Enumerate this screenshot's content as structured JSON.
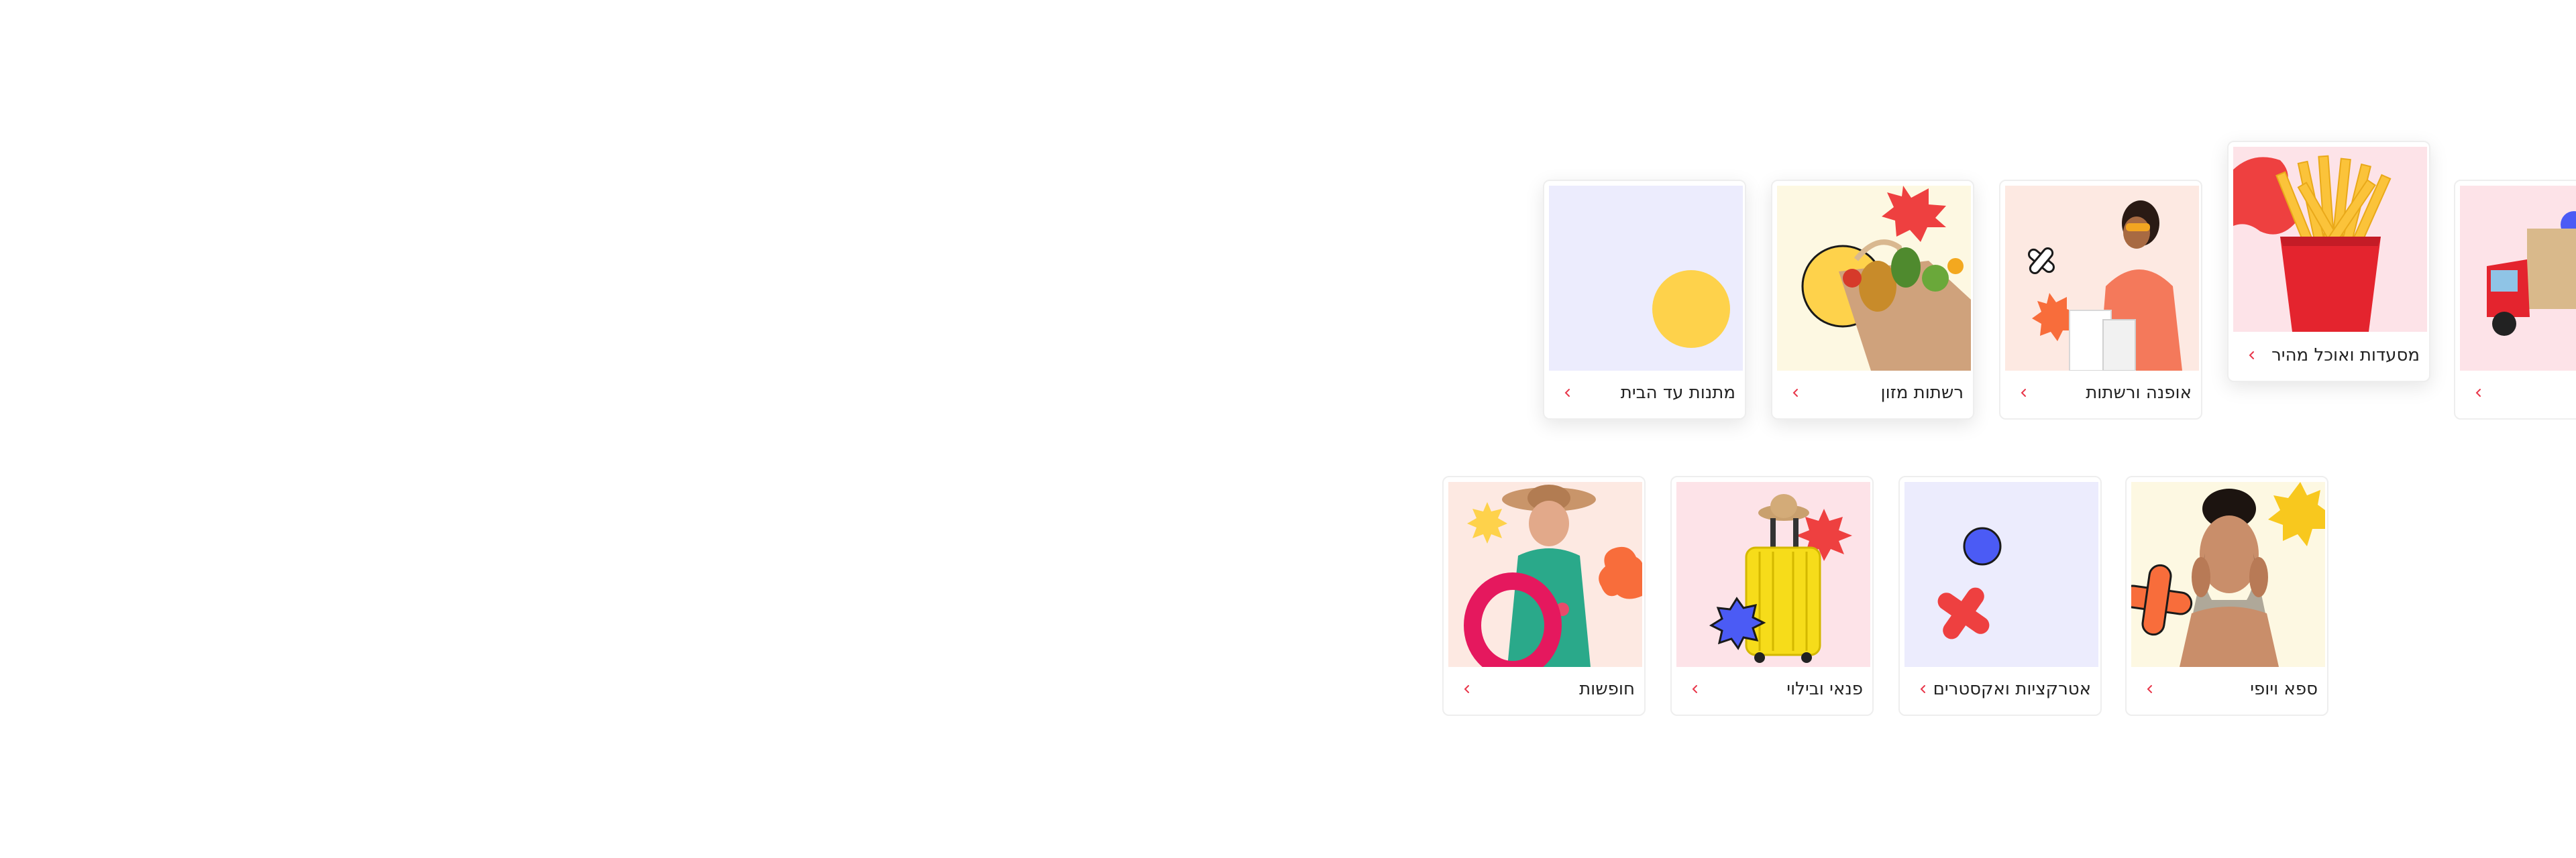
{
  "categories_row_1": [
    {
      "label": "מתנות עד הבית",
      "bg_color": "#ececfd"
    },
    {
      "label": "רשתות מזון",
      "bg_color": "#fdf8e2"
    },
    {
      "label": "אופנה ורשתות",
      "bg_color": "#fde9e2"
    },
    {
      "label": "מסעדות ואוכל מהיר",
      "bg_color": "#fde3e8"
    },
    {
      "label": "",
      "bg_color": "#fde3e8"
    }
  ],
  "categories_row_2": [
    {
      "label": "חופשות",
      "bg_color": "#fde9e2"
    },
    {
      "label": "פנאי ובילוי",
      "bg_color": "#fde3e8"
    },
    {
      "label": "אטרקציות ואקסטרים",
      "bg_color": "#ececfd"
    },
    {
      "label": "ספא ויופי",
      "bg_color": "#fdf8e2"
    }
  ],
  "chevron_icon": "chevron-left-icon",
  "accent_color": "#e8364a"
}
